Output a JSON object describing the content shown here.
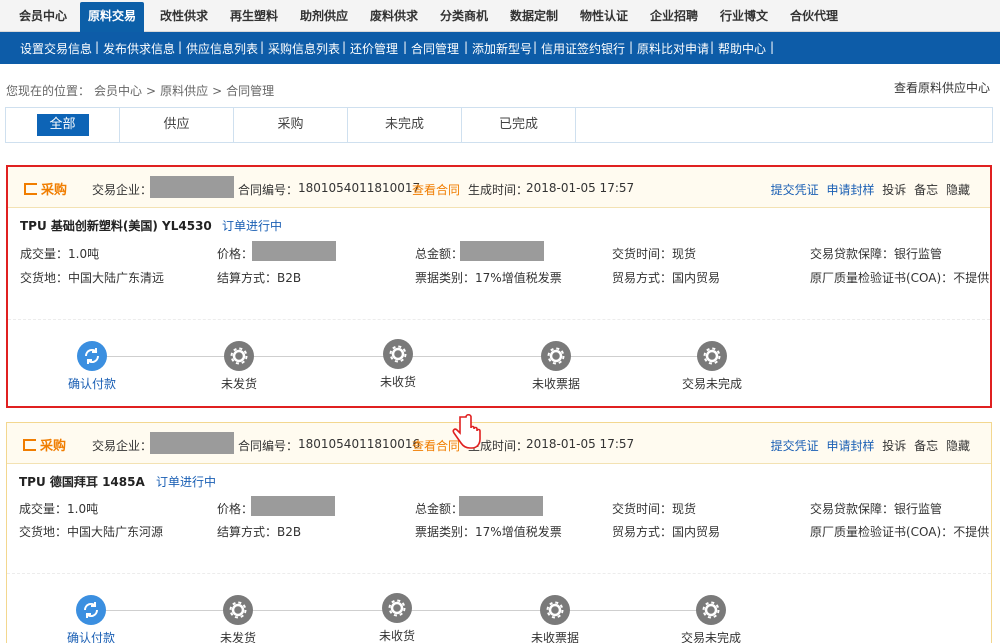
{
  "topnav": {
    "tabs": [
      "会员中心",
      "原料交易",
      "改性供求",
      "再生塑料",
      "助剂供应",
      "废料供求",
      "分类商机",
      "数据定制",
      "物性认证",
      "企业招聘",
      "行业博文",
      "合伙代理"
    ],
    "active": "原料交易"
  },
  "subnav": [
    "设置交易信息",
    "发布供求信息",
    "供应信息列表",
    "采购信息列表",
    "还价管理",
    "合同管理",
    "添加新型号",
    "信用证签约银行",
    "原料比对申请",
    "帮助中心"
  ],
  "breadcrumb": {
    "prefix": "您现在的位置：",
    "items": [
      "会员中心",
      "原料供应",
      "合同管理"
    ]
  },
  "supplier_link": "查看原料供应中心",
  "filters": [
    "全部",
    "供应",
    "采购",
    "未完成",
    "已完成"
  ],
  "labels": {
    "company": "交易企业：",
    "contract_no": "合同编号：",
    "view_contract": "查看合同",
    "created": "生成时间：",
    "volume": "成交量：",
    "price": "价格：",
    "total": "总金额：",
    "delivery_time": "交货时间：",
    "payment_guarantee": "交易贷款保障：",
    "delivery_place": "交货地：",
    "settlement": "结算方式：",
    "invoice": "票据类别：",
    "trade_mode": "贸易方式：",
    "coa": "原厂质量检验证书(COA)："
  },
  "actions": [
    "提交凭证",
    "申请封样",
    "投诉",
    "备忘",
    "隐藏"
  ],
  "cards": [
    {
      "tag": "采购",
      "contract_no": "1801054011810017",
      "created": "2018-01-05 17:57",
      "product": "TPU 基础创新塑料(美国) YL4530",
      "status": "订单进行中",
      "volume": "1.0吨",
      "delivery_time": "现货",
      "payment_guarantee": "银行监管",
      "delivery_place": "中国大陆广东清远",
      "settlement": "B2B",
      "invoice": "17%增值税发票",
      "trade_mode": "国内贸易",
      "coa": "不提供"
    },
    {
      "tag": "采购",
      "contract_no": "1801054011810016",
      "created": "2018-01-05 17:57",
      "product": "TPU 德国拜耳 1485A",
      "status": "订单进行中",
      "volume": "1.0吨",
      "delivery_time": "现货",
      "payment_guarantee": "银行监管",
      "delivery_place": "中国大陆广东河源",
      "settlement": "B2B",
      "invoice": "17%增值税发票",
      "trade_mode": "国内贸易",
      "coa": "不提供"
    }
  ],
  "steps": [
    "确认付款",
    "未发货",
    "未收货",
    "未收票据",
    "交易未完成"
  ],
  "colors": {
    "accent_blue": "#0d5ca8",
    "orange": "#f07d00",
    "highlight_red": "#e02020"
  }
}
